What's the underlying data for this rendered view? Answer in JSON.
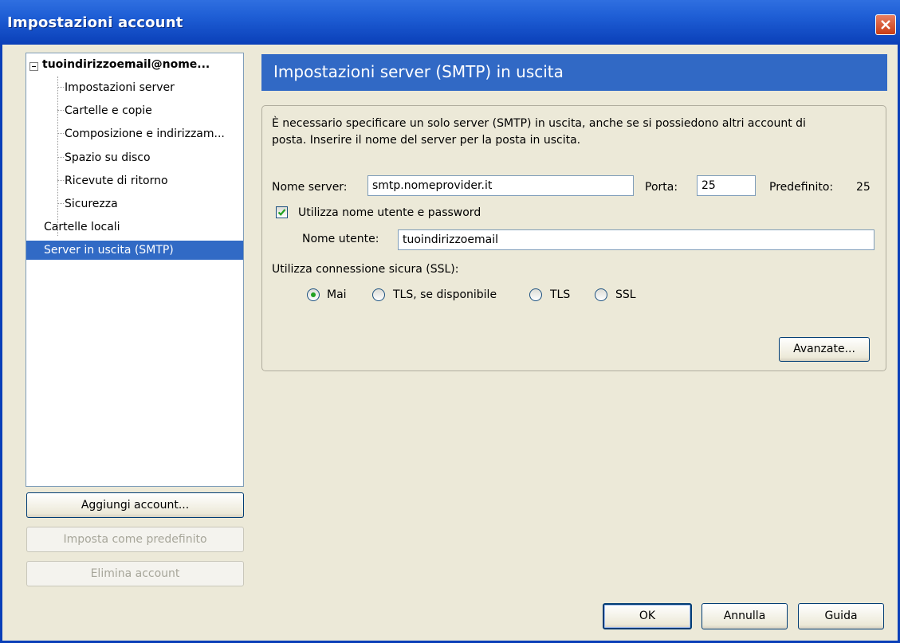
{
  "window": {
    "title": "Impostazioni account"
  },
  "tree": {
    "account": "tuoindirizzoemail@nome...",
    "children": [
      "Impostazioni server",
      "Cartelle e copie",
      "Composizione e indirizzam...",
      "Spazio su disco",
      "Ricevute di ritorno",
      "Sicurezza"
    ],
    "local_folders": "Cartelle locali",
    "smtp": "Server in uscita (SMTP)"
  },
  "left_buttons": {
    "add_account": "Aggiungi account...",
    "set_default": "Imposta come predefinito",
    "delete_account": "Elimina account"
  },
  "panel": {
    "title": "Impostazioni server (SMTP) in uscita",
    "description_line1": "È necessario specificare un solo server (SMTP) in uscita, anche se si possiedono altri account di",
    "description_line2": "posta. Inserire il nome del server per la posta in uscita.",
    "server_name_label": "Nome server:",
    "server_name_value": "smtp.nomeprovider.it",
    "port_label": "Porta:",
    "port_value": "25",
    "default_label": "Predefinito:",
    "default_value": "25",
    "use_auth_label": "Utilizza nome utente e password",
    "use_auth_checked": true,
    "username_label": "Nome utente:",
    "username_value": "tuoindirizzoemail",
    "ssl_label": "Utilizza connessione sicura (SSL):",
    "ssl_options": [
      "Mai",
      "TLS, se disponibile",
      "TLS",
      "SSL"
    ],
    "ssl_selected": "Mai",
    "advanced_button": "Avanzate..."
  },
  "footer": {
    "ok": "OK",
    "cancel": "Annulla",
    "help": "Guida"
  },
  "colors": {
    "titlebar": "#0a3fb8",
    "selection": "#316ac5",
    "header": "#3169c5",
    "close": "#c83c15"
  }
}
